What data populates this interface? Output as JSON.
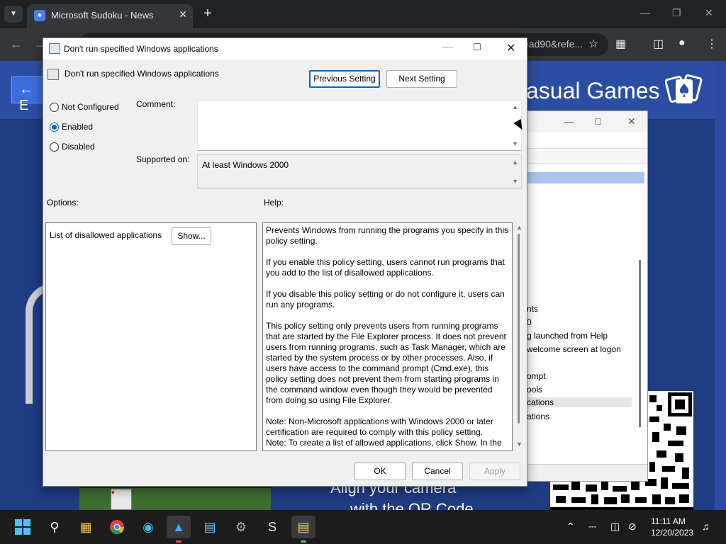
{
  "browser": {
    "tab_title": "Microsoft Sudoku - News",
    "tab_close_icon": "close-icon",
    "new_tab_icon": "plus-icon",
    "url_tail": "ead90&refe..."
  },
  "page": {
    "back_icon": "arrow-left-icon",
    "back_label": "E",
    "brand_title": "asual Games",
    "promo_line1": "Align your camera",
    "promo_line2": "with the QR Code"
  },
  "bg_window": {
    "items": [
      {
        "label": "nts",
        "highlighted": false
      },
      {
        "label": "0",
        "highlighted": false
      },
      {
        "label": "g launched from Help",
        "highlighted": false
      },
      {
        "label": "welcome screen at logon",
        "highlighted": false
      },
      {
        "label": "",
        "highlighted": false
      },
      {
        "label": "ompt",
        "highlighted": false
      },
      {
        "label": "ools",
        "highlighted": false
      },
      {
        "label": "cations",
        "highlighted": true
      },
      {
        "label": "ations",
        "highlighted": false
      }
    ]
  },
  "dialog": {
    "title": "Don't run specified Windows applications",
    "heading": "Don't run specified Windows applications",
    "prev_setting_label": "Previous Setting",
    "next_setting_label": "Next Setting",
    "radios": [
      {
        "label": "Not Configured",
        "selected": false
      },
      {
        "label": "Enabled",
        "selected": true
      },
      {
        "label": "Disabled",
        "selected": false
      }
    ],
    "comment_label": "Comment:",
    "comment_value": "",
    "supported_label": "Supported on:",
    "supported_value": "At least Windows 2000",
    "options_label": "Options:",
    "help_label": "Help:",
    "option_item_label": "List of disallowed applications",
    "show_button_label": "Show...",
    "help_paragraphs": [
      "Prevents Windows from running the programs you specify in this policy setting.",
      "If you enable this policy setting, users cannot run programs that you add to the list of disallowed applications.",
      "If you disable this policy setting or do not configure it, users can run any programs.",
      "This policy setting only prevents users from running programs that are started by the File Explorer process. It does not prevent users from running programs, such as Task Manager, which are started by the system process or by other processes.  Also, if users have access to the command prompt (Cmd.exe), this policy setting does not prevent them from starting programs in the command window even though they would be prevented from doing so using File Explorer.",
      "Note: Non-Microsoft applications with Windows 2000 or later certification are required to comply with this policy setting.",
      "Note: To create a list of allowed applications, click Show.  In the"
    ],
    "ok_label": "OK",
    "cancel_label": "Cancel",
    "apply_label": "Apply"
  },
  "taskbar": {
    "apps": [
      {
        "name": "start-icon"
      },
      {
        "name": "search-icon"
      },
      {
        "name": "file-explorer-icon"
      },
      {
        "name": "chrome-icon"
      },
      {
        "name": "edge-icon"
      },
      {
        "name": "photos-icon",
        "active": true
      },
      {
        "name": "notepad-icon"
      },
      {
        "name": "settings-icon"
      },
      {
        "name": "script-icon"
      },
      {
        "name": "policy-editor-icon",
        "active": true
      }
    ],
    "time": "11:11 AM",
    "date": "12/20/2023"
  }
}
